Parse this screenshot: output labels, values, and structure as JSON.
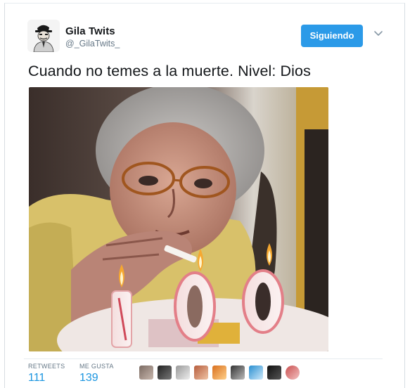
{
  "tweet": {
    "author": {
      "name": "Gila Twits",
      "handle": "@_GilaTwits_",
      "avatar": "man-with-hat-cartoon-avatar"
    },
    "follow_button_label": "Siguiendo",
    "menu_icon": "chevron-down-icon",
    "text": "Cuando no temes a la muerte. Nivel: Dios",
    "image": {
      "description_icon": "elderly-woman-lighting-cigarette-on-birthday-candles-photo",
      "candle_digits": [
        "1",
        "0",
        "0"
      ]
    },
    "stats": {
      "retweets_label": "RETWEETS",
      "retweets_value": "111",
      "likes_label": "ME GUSTA",
      "likes_value": "139"
    },
    "likers_count_shown": 9
  },
  "colors": {
    "accent": "#1b95e0",
    "button": "#2b9ae8",
    "text": "#14171a",
    "muted": "#657786"
  }
}
